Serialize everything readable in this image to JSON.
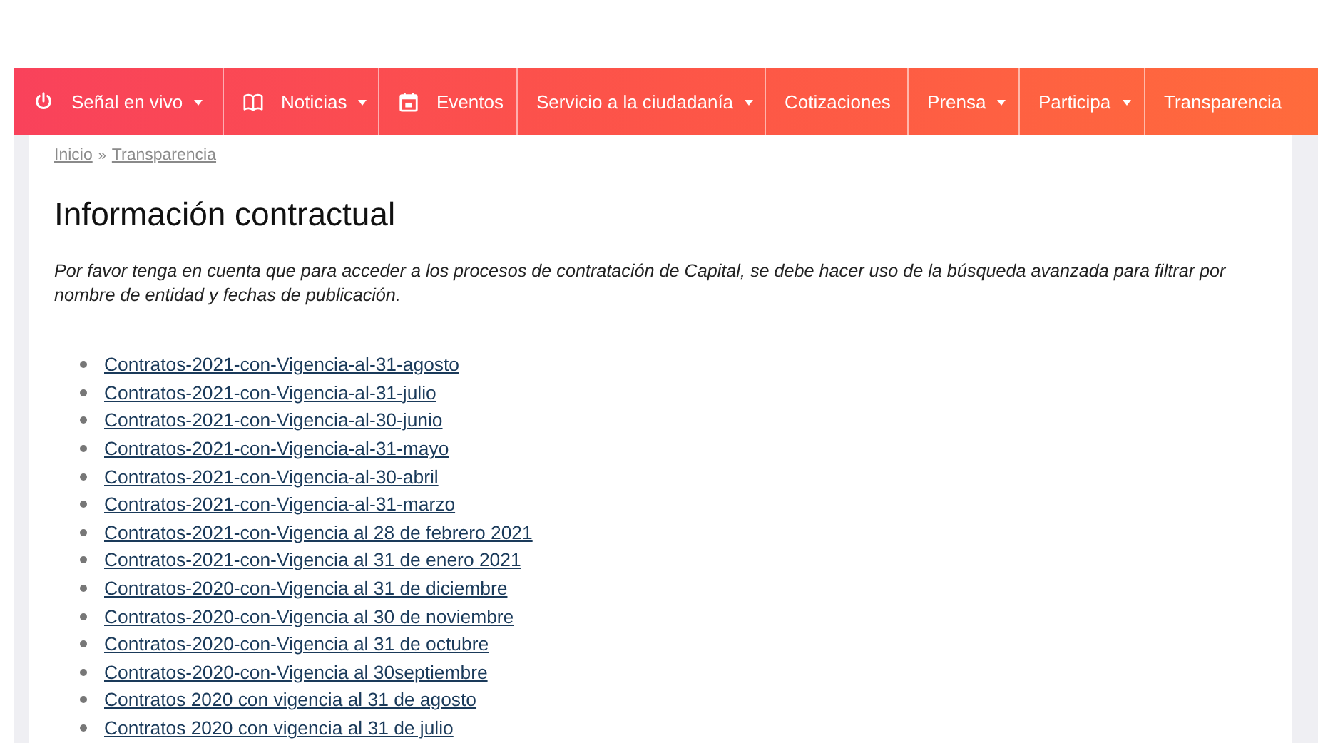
{
  "nav": [
    {
      "label": "Señal en vivo",
      "kind": "power",
      "dropdown": true
    },
    {
      "label": "Noticias",
      "kind": "book",
      "dropdown": true
    },
    {
      "label": "Eventos",
      "kind": "calendar",
      "dropdown": false
    },
    {
      "label": "Servicio a la ciudadanía",
      "kind": "text",
      "dropdown": true
    },
    {
      "label": "Cotizaciones",
      "kind": "text",
      "dropdown": false
    },
    {
      "label": "Prensa",
      "kind": "text",
      "dropdown": true
    },
    {
      "label": "Participa",
      "kind": "text",
      "dropdown": true
    },
    {
      "label": "Transparencia",
      "kind": "text",
      "dropdown": false
    }
  ],
  "breadcrumb": {
    "items": [
      "Inicio",
      "Transparencia"
    ],
    "separator": "»"
  },
  "title": "Información contractual",
  "notice": "Por favor tenga en cuenta que para acceder a los procesos de contratación de Capital, se debe hacer uso de la búsqueda avanzada para filtrar por nombre de entidad y fechas de publicación.",
  "links": [
    "Contratos-2021-con-Vigencia-al-31-agosto",
    "Contratos-2021-con-Vigencia-al-31-julio",
    "Contratos-2021-con-Vigencia-al-30-junio",
    "Contratos-2021-con-Vigencia-al-31-mayo",
    "Contratos-2021-con-Vigencia-al-30-abril",
    "Contratos-2021-con-Vigencia-al-31-marzo",
    "Contratos-2021-con-Vigencia al 28 de febrero 2021",
    "Contratos-2021-con-Vigencia al 31 de enero 2021",
    "Contratos-2020-con-Vigencia al 31 de diciembre",
    "Contratos-2020-con-Vigencia al 30 de noviembre",
    "Contratos-2020-con-Vigencia al 31 de octubre",
    "Contratos-2020-con-Vigencia al 30septiembre",
    "Contratos 2020 con vigencia al 31 de agosto",
    "Contratos 2020 con vigencia al 31 de julio"
  ]
}
